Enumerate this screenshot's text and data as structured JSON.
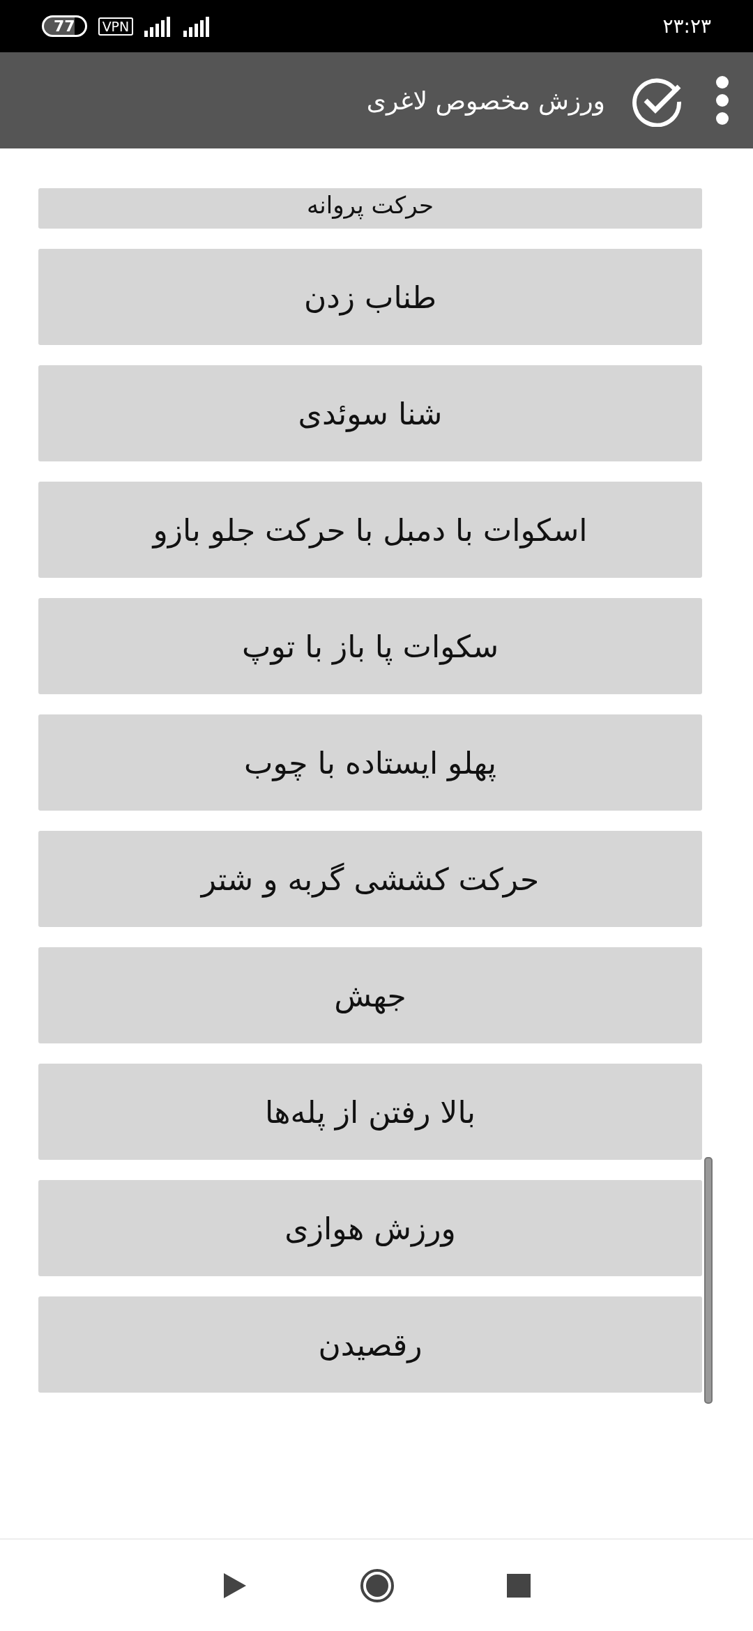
{
  "status_bar": {
    "battery": "77",
    "vpn": "VPN",
    "time": "۲۳:۲۳"
  },
  "app_bar": {
    "title": "ورزش مخصوص لاغری"
  },
  "exercises": [
    {
      "label": "حرکت پروانه",
      "partial": true
    },
    {
      "label": "طناب زدن",
      "partial": false
    },
    {
      "label": "شنا سوئدی",
      "partial": false
    },
    {
      "label": "اسکوات با دمبل با حرکت جلو بازو",
      "partial": false
    },
    {
      "label": "سکوات پا باز با توپ",
      "partial": false
    },
    {
      "label": "پهلو ایستاده با چوب",
      "partial": false
    },
    {
      "label": "حرکت کششی گربه و شتر",
      "partial": false
    },
    {
      "label": "جهش",
      "partial": false
    },
    {
      "label": "بالا رفتن از پله‌ها",
      "partial": false
    },
    {
      "label": "ورزش هوازی",
      "partial": false
    },
    {
      "label": "رقصیدن",
      "partial": false
    }
  ]
}
